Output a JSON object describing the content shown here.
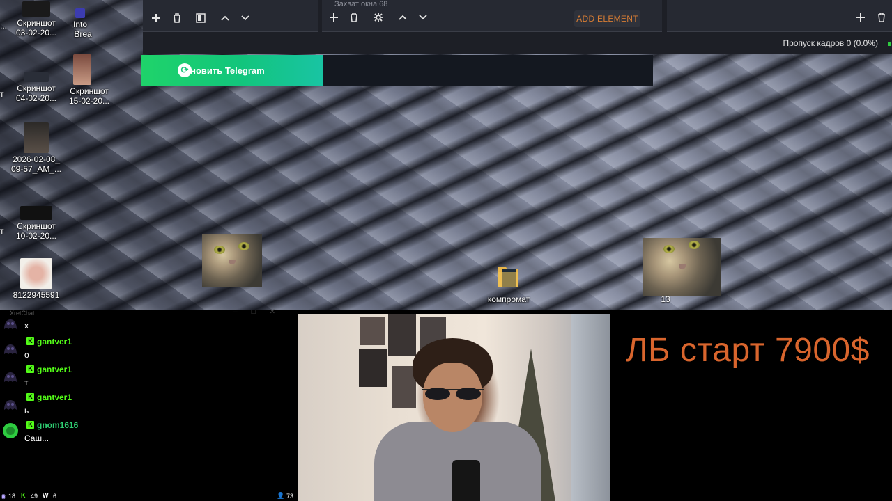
{
  "desktop": {
    "icons": [
      {
        "line1": "Скриншот",
        "line2": "03-02-20..."
      },
      {
        "line1": "Into",
        "line2": "Brea"
      },
      {
        "line1": "Скриншот",
        "line2": "04-02-20..."
      },
      {
        "line1": "Скриншот",
        "line2": "15-02-20..."
      },
      {
        "line1": "2026-02-08_",
        "line2": "09-57_AM_..."
      },
      {
        "line1": "Скриншот",
        "line2": "10-02-20..."
      },
      {
        "line1": "8122945591",
        "line2": ""
      }
    ],
    "cut_labels": [
      "...",
      "т",
      "т"
    ],
    "files": {
      "folder_label": "компромат",
      "cat2_label": "13"
    }
  },
  "obs": {
    "capture_tab": "Захват окна 68",
    "add_element": "ADD ELEMENT",
    "dropped_frames": "Пропуск кадров 0 (0.0%)"
  },
  "telegram": {
    "label": "Обновить Telegram"
  },
  "chat": {
    "title": "XretChat",
    "messages": [
      {
        "user": "",
        "text": "х",
        "user_color": "#53fc18"
      },
      {
        "user": "gantver1",
        "text": "о",
        "user_color": "#53fc18"
      },
      {
        "user": "gantver1",
        "text": "т",
        "user_color": "#53fc18"
      },
      {
        "user": "gantver1",
        "text": "ь",
        "user_color": "#53fc18"
      },
      {
        "user": "gnom1616",
        "text": "Саш...",
        "user_color": "#2ecc71"
      }
    ],
    "footer": {
      "count_a": "18",
      "count_k": "49",
      "count_w": "6",
      "viewers": "73"
    }
  },
  "stream": {
    "promo_text": "ЛБ старт 7900$"
  },
  "colors": {
    "accent_orange": "#d87d34",
    "promo_orange": "#d9652d",
    "kick_green": "#53fc18",
    "telegram_green": "#1fd36a"
  }
}
